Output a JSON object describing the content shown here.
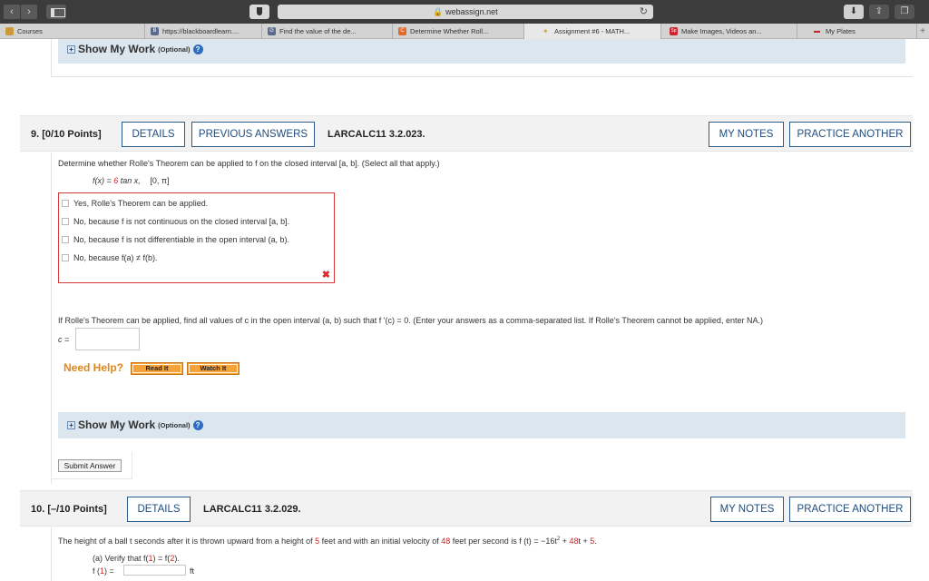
{
  "browser": {
    "url": "webassign.net",
    "tabs": [
      {
        "label": "Courses",
        "color": "#c99a3a"
      },
      {
        "label": "https://blackboardlearn....",
        "color": "#5a6b8c"
      },
      {
        "label": "Find the value of the de...",
        "color": "#5a6b8c"
      },
      {
        "label": "Determine Whether Roll...",
        "color": "#e46a2a"
      },
      {
        "label": "Assignment #6 - MATH...",
        "color": "#d6a232"
      },
      {
        "label": "Make Images, Videos an...",
        "color": "#c8262a"
      },
      {
        "label": "My Plates",
        "color": "#c8262a"
      }
    ],
    "tab_icons": [
      "",
      "B",
      "G",
      "C",
      "✦",
      "Sp",
      "▬"
    ]
  },
  "top_showwork": {
    "label": "Show My Work",
    "optional": "(Optional)",
    "help": "?"
  },
  "q9": {
    "number": "9.",
    "points": "[0/10 Points]",
    "details": "DETAILS",
    "previous_answers": "PREVIOUS ANSWERS",
    "code": "LARCALC11 3.2.023.",
    "my_notes": "MY NOTES",
    "practice_another": "PRACTICE ANOTHER",
    "prompt": "Determine whether Rolle's Theorem can be applied to f on the closed interval [a, b]. (Select all that apply.)",
    "function_pre": "f(x) = ",
    "function_red": "6",
    "function_post": " tan x,",
    "interval": "[0, π]",
    "choices": [
      "Yes, Rolle's Theorem can be applied.",
      "No, because f is not continuous on the closed interval [a, b].",
      "No, because f is not differentiable in the open interval (a, b).",
      "No, because f(a) ≠ f(b)."
    ],
    "wrong_mark": "✖",
    "part2_prompt": "If Rolle's Theorem can be applied, find all values of c in the open interval (a, b) such that f '(c) = 0. (Enter your answers as a comma-separated list. If Rolle's Theorem cannot be applied, enter NA.)",
    "c_label": "c =",
    "c_value": "",
    "need_help": "Need Help?",
    "read_it": "Read It",
    "watch_it": "Watch It",
    "showwork": {
      "label": "Show My Work",
      "optional": "(Optional)",
      "help": "?"
    },
    "submit": "Submit Answer"
  },
  "q10": {
    "number": "10.",
    "points": "[–/10 Points]",
    "details": "DETAILS",
    "code": "LARCALC11 3.2.029.",
    "my_notes": "MY NOTES",
    "practice_another": "PRACTICE ANOTHER",
    "prompt_a": "The height of a ball t seconds after it is thrown upward from a height of ",
    "prompt_red1": "5",
    "prompt_b": " feet and with an initial velocity of ",
    "prompt_red2": "48",
    "prompt_c": " feet per second is f (t) = −16t",
    "prompt_sup": "2",
    "prompt_d": " + ",
    "prompt_red3": "48",
    "prompt_e": "t + ",
    "prompt_red4": "5",
    "prompt_f": ".",
    "part_a_pre": "(a) Verify that f(",
    "part_a_red1": "1",
    "part_a_mid": ") = f(",
    "part_a_red2": "2",
    "part_a_post": ").",
    "f1_pre": "f (",
    "f1_red": "1",
    "f1_post": ") =",
    "unit": "ft"
  }
}
